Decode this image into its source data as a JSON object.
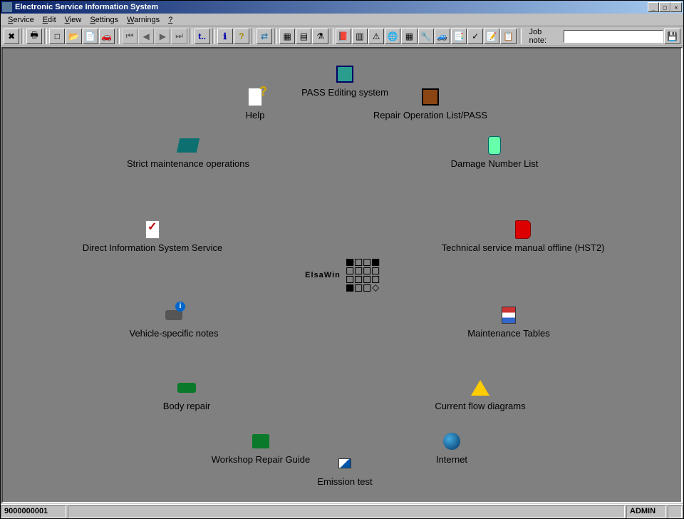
{
  "title": "Electronic Service Information System",
  "menus": {
    "service": "Service",
    "edit": "Edit",
    "view": "View",
    "settings": "Settings",
    "warnings": "Warnings",
    "help": "?"
  },
  "toolbar": {
    "job_note_label": "Job note:"
  },
  "icons": {
    "pass": "PASS Editing system",
    "help": "Help",
    "repair": "Repair Operation List/PASS",
    "strict": "Strict maintenance operations",
    "damage": "Damage Number List",
    "direct": "Direct Information System Service",
    "manual": "Technical service manual offline (HST2)",
    "vehicle": "Vehicle-specific notes",
    "tables": "Maintenance Tables",
    "body": "Body repair",
    "flow": "Current flow diagrams",
    "workshop": "Workshop Repair Guide",
    "internet": "Internet",
    "emission": "Emission test"
  },
  "watermark": "ElsaWin",
  "status": {
    "id": "9000000001",
    "user": "ADMIN"
  }
}
